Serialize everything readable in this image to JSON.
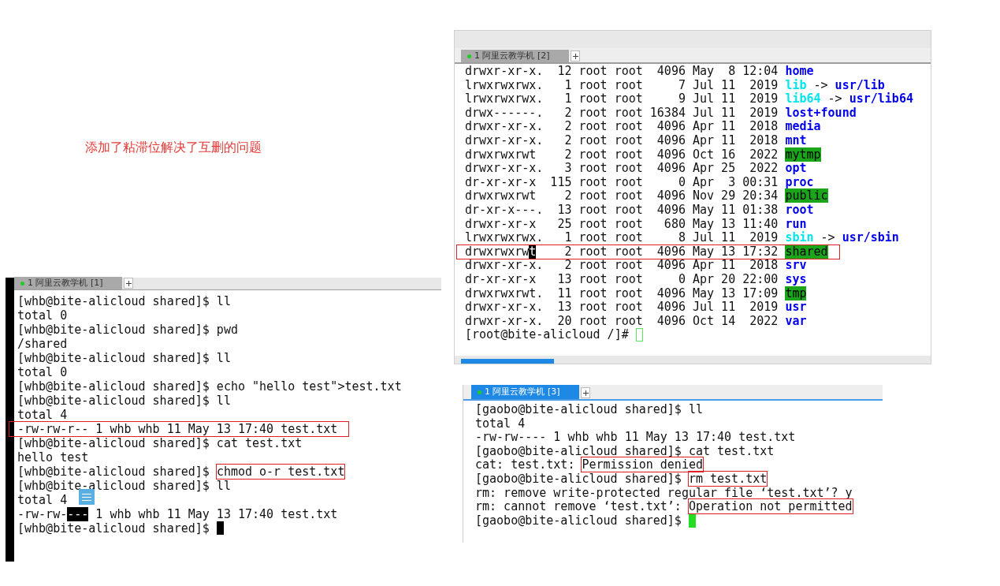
{
  "caption": "添加了粘滞位解决了互删的问题",
  "terminals": [
    {
      "tab_label": "1 阿里云教学机 [2]",
      "tab_active": false,
      "lines": [
        {
          "segments": [
            {
              "text": "drwxr-xr-x.  12 root root  4096 May  8 12:04 ",
              "kind": "plain"
            },
            {
              "text": "home",
              "kind": "dir"
            }
          ]
        },
        {
          "segments": [
            {
              "text": "lrwxrwxrwx.   1 root root     7 Jul 11  2019 ",
              "kind": "plain"
            },
            {
              "text": "lib",
              "kind": "link"
            },
            {
              "text": " -> ",
              "kind": "plain"
            },
            {
              "text": "usr/lib",
              "kind": "dir"
            }
          ]
        },
        {
          "segments": [
            {
              "text": "lrwxrwxrwx.   1 root root     9 Jul 11  2019 ",
              "kind": "plain"
            },
            {
              "text": "lib64",
              "kind": "link"
            },
            {
              "text": " -> ",
              "kind": "plain"
            },
            {
              "text": "usr/lib64",
              "kind": "dir"
            }
          ]
        },
        {
          "segments": [
            {
              "text": "drwx------.   2 root root 16384 Jul 11  2019 ",
              "kind": "plain"
            },
            {
              "text": "lost+found",
              "kind": "dir"
            }
          ]
        },
        {
          "segments": [
            {
              "text": "drwxr-xr-x.   2 root root  4096 Apr 11  2018 ",
              "kind": "plain"
            },
            {
              "text": "media",
              "kind": "dir"
            }
          ]
        },
        {
          "segments": [
            {
              "text": "drwxr-xr-x.   2 root root  4096 Apr 11  2018 ",
              "kind": "plain"
            },
            {
              "text": "mnt",
              "kind": "dir"
            }
          ]
        },
        {
          "segments": [
            {
              "text": "drwxrwxrwt    2 root root  4096 Oct 16  2022 ",
              "kind": "plain"
            },
            {
              "text": "mytmp",
              "kind": "sticky"
            }
          ]
        },
        {
          "segments": [
            {
              "text": "drwxr-xr-x.   3 root root  4096 Apr 25  2022 ",
              "kind": "plain"
            },
            {
              "text": "opt",
              "kind": "dir"
            }
          ]
        },
        {
          "segments": [
            {
              "text": "dr-xr-xr-x  115 root root     0 Apr  3 00:31 ",
              "kind": "plain"
            },
            {
              "text": "proc",
              "kind": "dir"
            }
          ]
        },
        {
          "segments": [
            {
              "text": "drwxrwxrwt    2 root root  4096 Nov 29 20:34 ",
              "kind": "plain"
            },
            {
              "text": "public",
              "kind": "sticky"
            }
          ]
        },
        {
          "segments": [
            {
              "text": "dr-xr-x---.  13 root root  4096 May 11 01:38 ",
              "kind": "plain"
            },
            {
              "text": "root",
              "kind": "dir"
            }
          ]
        },
        {
          "segments": [
            {
              "text": "drwxr-xr-x   25 root root   680 May 13 11:40 ",
              "kind": "plain"
            },
            {
              "text": "run",
              "kind": "dir"
            }
          ]
        },
        {
          "segments": [
            {
              "text": "lrwxrwxrwx.   1 root root     8 Jul 11  2019 ",
              "kind": "plain"
            },
            {
              "text": "sbin",
              "kind": "link"
            },
            {
              "text": " -> ",
              "kind": "plain"
            },
            {
              "text": "usr/sbin",
              "kind": "dir"
            }
          ]
        },
        {
          "boxed": true,
          "segments": [
            {
              "text": "drwxrwxrw",
              "kind": "plain"
            },
            {
              "text": "t",
              "kind": "inverse"
            },
            {
              "text": "    2 root root  4096 May 13 17:32 ",
              "kind": "plain"
            },
            {
              "text": "shared",
              "kind": "sticky"
            }
          ]
        },
        {
          "segments": [
            {
              "text": "drwxr-xr-x.   2 root root  4096 Apr 11  2018 ",
              "kind": "plain"
            },
            {
              "text": "srv",
              "kind": "dir"
            }
          ]
        },
        {
          "segments": [
            {
              "text": "dr-xr-xr-x   13 root root     0 Apr 20 22:00 ",
              "kind": "plain"
            },
            {
              "text": "sys",
              "kind": "dir"
            }
          ]
        },
        {
          "segments": [
            {
              "text": "drwxrwxrwt.  11 root root  4096 May 13 17:09 ",
              "kind": "plain"
            },
            {
              "text": "tmp",
              "kind": "sticky"
            }
          ]
        },
        {
          "segments": [
            {
              "text": "drwxr-xr-x.  13 root root  4096 Jul 11  2019 ",
              "kind": "plain"
            },
            {
              "text": "usr",
              "kind": "dir"
            }
          ]
        },
        {
          "segments": [
            {
              "text": "drwxr-xr-x.  20 root root  4096 Oct 14  2022 ",
              "kind": "plain"
            },
            {
              "text": "var",
              "kind": "dir"
            }
          ]
        },
        {
          "segments": [
            {
              "text": "[root@bite-alicloud /]# ",
              "kind": "plain"
            },
            {
              "kind": "hollow_cursor"
            }
          ]
        }
      ]
    },
    {
      "tab_label": "1 阿里云教学机 [1]",
      "tab_active": false,
      "lines": [
        {
          "segments": [
            {
              "text": "[whb@bite-alicloud shared]$ ll",
              "kind": "plain"
            }
          ]
        },
        {
          "segments": [
            {
              "text": "total 0",
              "kind": "plain"
            }
          ]
        },
        {
          "segments": [
            {
              "text": "[whb@bite-alicloud shared]$ pwd",
              "kind": "plain"
            }
          ]
        },
        {
          "segments": [
            {
              "text": "/shared",
              "kind": "plain"
            }
          ]
        },
        {
          "segments": [
            {
              "text": "[whb@bite-alicloud shared]$ ll",
              "kind": "plain"
            }
          ]
        },
        {
          "segments": [
            {
              "text": "total 0",
              "kind": "plain"
            }
          ]
        },
        {
          "segments": [
            {
              "text": "[whb@bite-alicloud shared]$ echo \"hello test\">test.txt",
              "kind": "plain"
            }
          ]
        },
        {
          "segments": [
            {
              "text": "[whb@bite-alicloud shared]$ ll",
              "kind": "plain"
            }
          ]
        },
        {
          "segments": [
            {
              "text": "total 4",
              "kind": "plain"
            }
          ]
        },
        {
          "boxed": true,
          "segments": [
            {
              "text": "-rw-rw-r-- 1 whb whb 11 May 13 17:40 test.txt",
              "kind": "plain"
            }
          ]
        },
        {
          "segments": [
            {
              "text": "[whb@bite-alicloud shared]$ cat test.txt",
              "kind": "plain"
            }
          ]
        },
        {
          "segments": [
            {
              "text": "hello test",
              "kind": "plain"
            }
          ]
        },
        {
          "segments": [
            {
              "text": "[whb@bite-alicloud shared]$ ",
              "kind": "plain"
            },
            {
              "text": "chmod o-r test.txt",
              "kind": "plain",
              "boxed": true
            }
          ]
        },
        {
          "segments": [
            {
              "text": "[whb@bite-alicloud shared]$ ll",
              "kind": "plain"
            }
          ]
        },
        {
          "segments": [
            {
              "text": "total 4",
              "kind": "plain"
            }
          ]
        },
        {
          "segments": [
            {
              "text": "-rw-rw-",
              "kind": "plain"
            },
            {
              "text": "---",
              "kind": "inverse"
            },
            {
              "text": " 1 whb whb 11 May 13 17:40 test.txt",
              "kind": "plain"
            }
          ]
        },
        {
          "segments": [
            {
              "text": "[whb@bite-alicloud shared]$ ",
              "kind": "plain"
            },
            {
              "kind": "block_cursor"
            }
          ]
        }
      ]
    },
    {
      "tab_label": "1 阿里云教学机 [3]",
      "tab_active": true,
      "lines": [
        {
          "segments": [
            {
              "text": "[gaobo@bite-alicloud shared]$ ll",
              "kind": "plain"
            }
          ]
        },
        {
          "segments": [
            {
              "text": "total 4",
              "kind": "plain"
            }
          ]
        },
        {
          "segments": [
            {
              "text": "-rw-rw---- 1 whb whb 11 May 13 17:40 test.txt",
              "kind": "plain"
            }
          ]
        },
        {
          "segments": [
            {
              "text": "[gaobo@bite-alicloud shared]$ cat test.txt",
              "kind": "plain"
            }
          ]
        },
        {
          "segments": [
            {
              "text": "cat: test.txt: ",
              "kind": "plain"
            },
            {
              "text": "Permission denied",
              "kind": "plain",
              "boxed": true
            }
          ]
        },
        {
          "segments": [
            {
              "text": "[gaobo@bite-alicloud shared]$ ",
              "kind": "plain"
            },
            {
              "text": "rm test.txt",
              "kind": "plain",
              "boxed": true
            }
          ]
        },
        {
          "segments": [
            {
              "text": "rm: remove write-protected regular file ‘test.txt’? y",
              "kind": "plain"
            }
          ]
        },
        {
          "segments": [
            {
              "text": "rm: cannot remove ‘test.txt’: ",
              "kind": "plain"
            },
            {
              "text": "Operation not permitted",
              "kind": "plain",
              "boxed": true
            }
          ]
        },
        {
          "segments": [
            {
              "text": "[gaobo@bite-alicloud shared]$ ",
              "kind": "plain"
            },
            {
              "kind": "green_cursor"
            }
          ]
        }
      ]
    }
  ]
}
